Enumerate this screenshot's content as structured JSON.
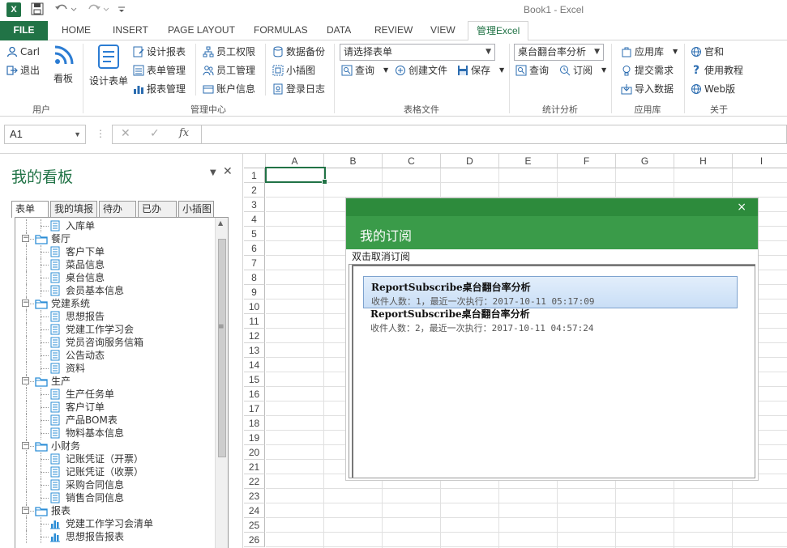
{
  "window": {
    "title": "Book1 - Excel"
  },
  "tabs": [
    "FILE",
    "HOME",
    "INSERT",
    "PAGE LAYOUT",
    "FORMULAS",
    "DATA",
    "REVIEW",
    "VIEW",
    "管理Excel"
  ],
  "ribbon": {
    "user_group": {
      "label": "用户",
      "user": "Carl",
      "logout": "退出",
      "board": "看板"
    },
    "mgmt_group": {
      "label": "管理中心",
      "design_form": "设计表单",
      "design_report": "设计报表",
      "form_mgmt": "表单管理",
      "report_mgmt": "报表管理",
      "staff_perm": "员工权限",
      "staff_mgmt": "员工管理",
      "account_info": "账户信息",
      "data_backup": "数据备份",
      "small_chart": "小插图",
      "login_log": "登录日志"
    },
    "file_group": {
      "label": "表格文件",
      "select_placeholder": "请选择表单",
      "query": "查询",
      "create_file": "创建文件",
      "save": "保存"
    },
    "stats_group": {
      "label": "统计分析",
      "select_value": "桌台翻台率分析",
      "query": "查询",
      "subscribe": "订阅"
    },
    "app_group": {
      "label": "应用库",
      "app_store": "应用库",
      "submit_req": "提交需求",
      "import_data": "导入数据"
    },
    "about_group": {
      "label": "关于",
      "official": "官和",
      "tutorial": "使用教程",
      "web": "Web版"
    }
  },
  "formula_bar": {
    "name_box": "A1",
    "fx": "fx"
  },
  "panel": {
    "title": "我的看板",
    "tabs": [
      "表单",
      "我的填报",
      "待办",
      "已办",
      "小插图"
    ],
    "tree": [
      {
        "label": "入库单",
        "level": 1,
        "type": "doc"
      },
      {
        "label": "餐厅",
        "level": 0,
        "type": "folder"
      },
      {
        "label": "客户下单",
        "level": 1,
        "type": "doc"
      },
      {
        "label": "菜品信息",
        "level": 1,
        "type": "doc"
      },
      {
        "label": "桌台信息",
        "level": 1,
        "type": "doc"
      },
      {
        "label": "会员基本信息",
        "level": 1,
        "type": "doc"
      },
      {
        "label": "党建系统",
        "level": 0,
        "type": "folder"
      },
      {
        "label": "思想报告",
        "level": 1,
        "type": "doc"
      },
      {
        "label": "党建工作学习会",
        "level": 1,
        "type": "doc"
      },
      {
        "label": "党员咨询服务信箱",
        "level": 1,
        "type": "doc"
      },
      {
        "label": "公告动态",
        "level": 1,
        "type": "doc"
      },
      {
        "label": "资料",
        "level": 1,
        "type": "doc"
      },
      {
        "label": "生产",
        "level": 0,
        "type": "folder"
      },
      {
        "label": "生产任务单",
        "level": 1,
        "type": "doc"
      },
      {
        "label": "客户订单",
        "level": 1,
        "type": "doc"
      },
      {
        "label": "产品BOM表",
        "level": 1,
        "type": "doc"
      },
      {
        "label": "物料基本信息",
        "level": 1,
        "type": "doc"
      },
      {
        "label": "小财务",
        "level": 0,
        "type": "folder"
      },
      {
        "label": "记账凭证（开票）",
        "level": 1,
        "type": "doc"
      },
      {
        "label": "记账凭证（收票）",
        "level": 1,
        "type": "doc"
      },
      {
        "label": "采购合同信息",
        "level": 1,
        "type": "doc"
      },
      {
        "label": "销售合同信息",
        "level": 1,
        "type": "doc"
      },
      {
        "label": "报表",
        "level": 0,
        "type": "folder"
      },
      {
        "label": "党建工作学习会清单",
        "level": 1,
        "type": "report"
      },
      {
        "label": "思想报告报表",
        "level": 1,
        "type": "report"
      }
    ]
  },
  "sheet": {
    "columns": [
      "A",
      "B",
      "C",
      "D",
      "E",
      "F",
      "G",
      "H",
      "I"
    ],
    "rows": [
      "1",
      "2",
      "3",
      "4",
      "5",
      "6",
      "7",
      "8",
      "9",
      "10",
      "11",
      "12",
      "13",
      "14",
      "15",
      "16",
      "17",
      "18",
      "19",
      "20",
      "21",
      "22",
      "23",
      "24",
      "25",
      "26"
    ],
    "selected_cell": "A1"
  },
  "dialog": {
    "title": "我的订阅",
    "close": "×",
    "hint": "双击取消订阅",
    "items": [
      {
        "name": "ReportSubscribe桌台翻台率分析",
        "meta": "收件人数：1，最近一次执行：2017-10-11 05:17:09",
        "selected": true
      },
      {
        "name": "ReportSubscribe桌台翻台率分析",
        "meta": "收件人数：2，最近一次执行：2017-10-11 04:57:24",
        "selected": false
      }
    ]
  },
  "colors": {
    "excel_green": "#217346",
    "dialog_green": "#3a9b49",
    "selection_blue": "#c9def6"
  }
}
